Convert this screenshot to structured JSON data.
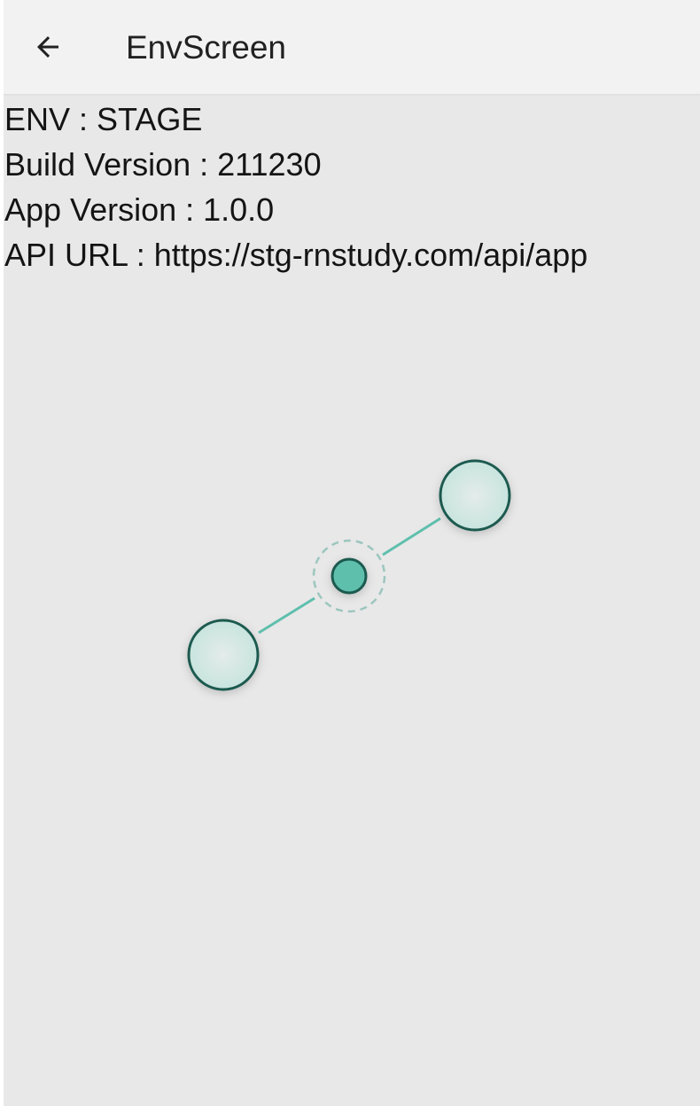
{
  "app_bar": {
    "title": "EnvScreen",
    "back_icon": "arrow-left-icon"
  },
  "env_info": {
    "env": "ENV : STAGE",
    "build_version": "Build Version : 211230",
    "app_version": "App Version : 1.0.0",
    "api_url": "API URL : https://stg-rnstudy.com/api/app"
  },
  "gesture_overlay": {
    "type": "pinch-zoom-indicator",
    "accent_color": "#5fbfad",
    "touch_fill_color": "#cfe7e2",
    "outline_color": "#1f5a50"
  }
}
